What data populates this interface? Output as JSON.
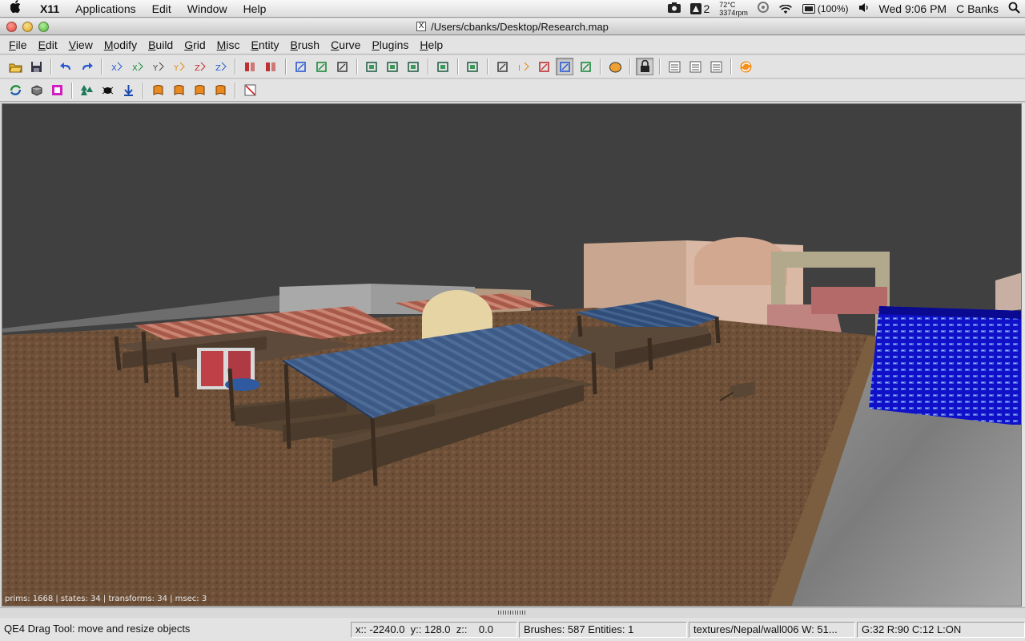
{
  "macbar": {
    "apple": "",
    "app_name": "X11",
    "menus": [
      "Applications",
      "Edit",
      "Window",
      "Help"
    ],
    "spaces_num": "2",
    "temp_line1": "72°C",
    "temp_line2": "3374rpm",
    "battery": "(100%)",
    "clock": "Wed 9:06 PM",
    "user": "C Banks"
  },
  "window": {
    "title": "/Users/cbanks/Desktop/Research.map",
    "x_glyph": "X"
  },
  "appmenu": [
    {
      "u": "F",
      "rest": "ile"
    },
    {
      "u": "E",
      "rest": "dit"
    },
    {
      "u": "V",
      "rest": "iew"
    },
    {
      "u": "M",
      "rest": "odify"
    },
    {
      "u": "B",
      "rest": "uild"
    },
    {
      "u": "G",
      "rest": "rid"
    },
    {
      "u": "M",
      "rest": "isc"
    },
    {
      "u": "E",
      "rest": "ntity"
    },
    {
      "u": "B",
      "rest": "rush"
    },
    {
      "u": "C",
      "rest": "urve"
    },
    {
      "u": "P",
      "rest": "lugins"
    },
    {
      "u": "H",
      "rest": "elp"
    }
  ],
  "toolbar_icons": {
    "row1": [
      "open-icon",
      "save-icon",
      "|",
      "undo-icon",
      "redo-icon",
      "|",
      "flip-x-icon",
      "rotate-x-icon",
      "flip-y-icon",
      "rotate-y-icon",
      "flip-z-icon",
      "rotate-z-icon",
      "|",
      "csg-subtract-icon",
      "csg-merge-icon",
      "|",
      "clipper-icon",
      "split-icon",
      "hollow-icon",
      "|",
      "cube-view-icon",
      "camera-view-icon",
      "texture-view-icon",
      "|",
      "xy-view-icon",
      "|",
      "change-view-icon",
      "|",
      "move-icon",
      "rotate-icon",
      "scale-icon",
      "drag-select-icon",
      "resize-icon",
      "|",
      "entity-icon",
      "|",
      "lock-icon",
      "|",
      "list-icon",
      "text-icon",
      "grid-icon",
      "|",
      "refresh-icon"
    ],
    "row2": [
      "refresh-map-icon",
      "brush-icon",
      "texture-icon",
      "|",
      "tree-icon",
      "entity-bug-icon",
      "drop-icon",
      "|",
      "patch-icon",
      "patch-cap-icon",
      "patch-bevel-icon",
      "patch-endcap-icon",
      "|",
      "invalid-icon"
    ]
  },
  "viewport": {
    "stats": "prims: 1668 | states: 34 | transforms: 34 | msec: 3"
  },
  "status": {
    "tool": "QE4 Drag Tool: move and resize objects",
    "coords": "x:: -2240.0  y:: 128.0  z::    0.0",
    "counts": "Brushes: 587 Entities: 1",
    "texture": "textures/Nepal/wall006 W: 51...",
    "grid": "G:32  R:90  C:12  L:ON"
  },
  "colors": {
    "sky": "#404040",
    "ground": "#6e5038",
    "awning_blue": "#3d5a86",
    "awning_red": "#a85a4a",
    "wall_tan": "#c9a690"
  }
}
